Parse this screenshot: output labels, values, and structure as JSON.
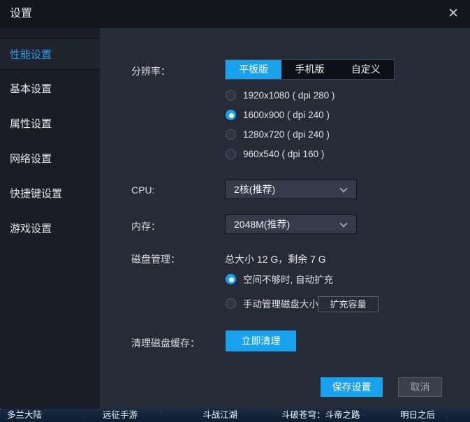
{
  "window": {
    "title": "设置",
    "close_icon": "✕"
  },
  "sidebar": {
    "items": [
      {
        "label": "性能设置",
        "selected": true
      },
      {
        "label": "基本设置",
        "selected": false
      },
      {
        "label": "属性设置",
        "selected": false
      },
      {
        "label": "网络设置",
        "selected": false
      },
      {
        "label": "快捷键设置",
        "selected": false
      },
      {
        "label": "游戏设置",
        "selected": false
      }
    ]
  },
  "main": {
    "resolution": {
      "label": "分辨率：",
      "tabs": [
        {
          "label": "平板版",
          "selected": true
        },
        {
          "label": "手机版",
          "selected": false
        },
        {
          "label": "自定义",
          "selected": false
        }
      ],
      "options": [
        {
          "label": "1920x1080 ( dpi 280 )",
          "selected": false
        },
        {
          "label": "1600x900 ( dpi 240 )",
          "selected": true
        },
        {
          "label": "1280x720 ( dpi 240 )",
          "selected": false
        },
        {
          "label": "960x540 ( dpi 160 )",
          "selected": false
        }
      ]
    },
    "cpu": {
      "label": "CPU:",
      "value": "2核(推荐)"
    },
    "memory": {
      "label": "内存：",
      "value": "2048M(推荐)"
    },
    "disk": {
      "label": "磁盘管理：",
      "summary": "总大小 12 G，剩余 7 G",
      "options": [
        {
          "label": "空间不够时, 自动扩充",
          "selected": true
        },
        {
          "label": "手动管理磁盘大小",
          "selected": false
        }
      ],
      "expand_button": "扩充容量"
    },
    "cache": {
      "label": "清理磁盘缓存：",
      "button": "立即清理"
    },
    "actions": {
      "save": "保存设置",
      "cancel": "取消"
    }
  },
  "bottom_bar": {
    "items": [
      "多兰大陆",
      "远征手游",
      "斗战江湖",
      "斗破苍穹：斗帝之路",
      "明日之后"
    ]
  },
  "colors": {
    "accent": "#18a2ee",
    "sidebar_selected_text": "#2b9fe8",
    "panel": "#262b38",
    "sidebar_bg": "#1a1d26",
    "header_bg": "#14161d"
  }
}
